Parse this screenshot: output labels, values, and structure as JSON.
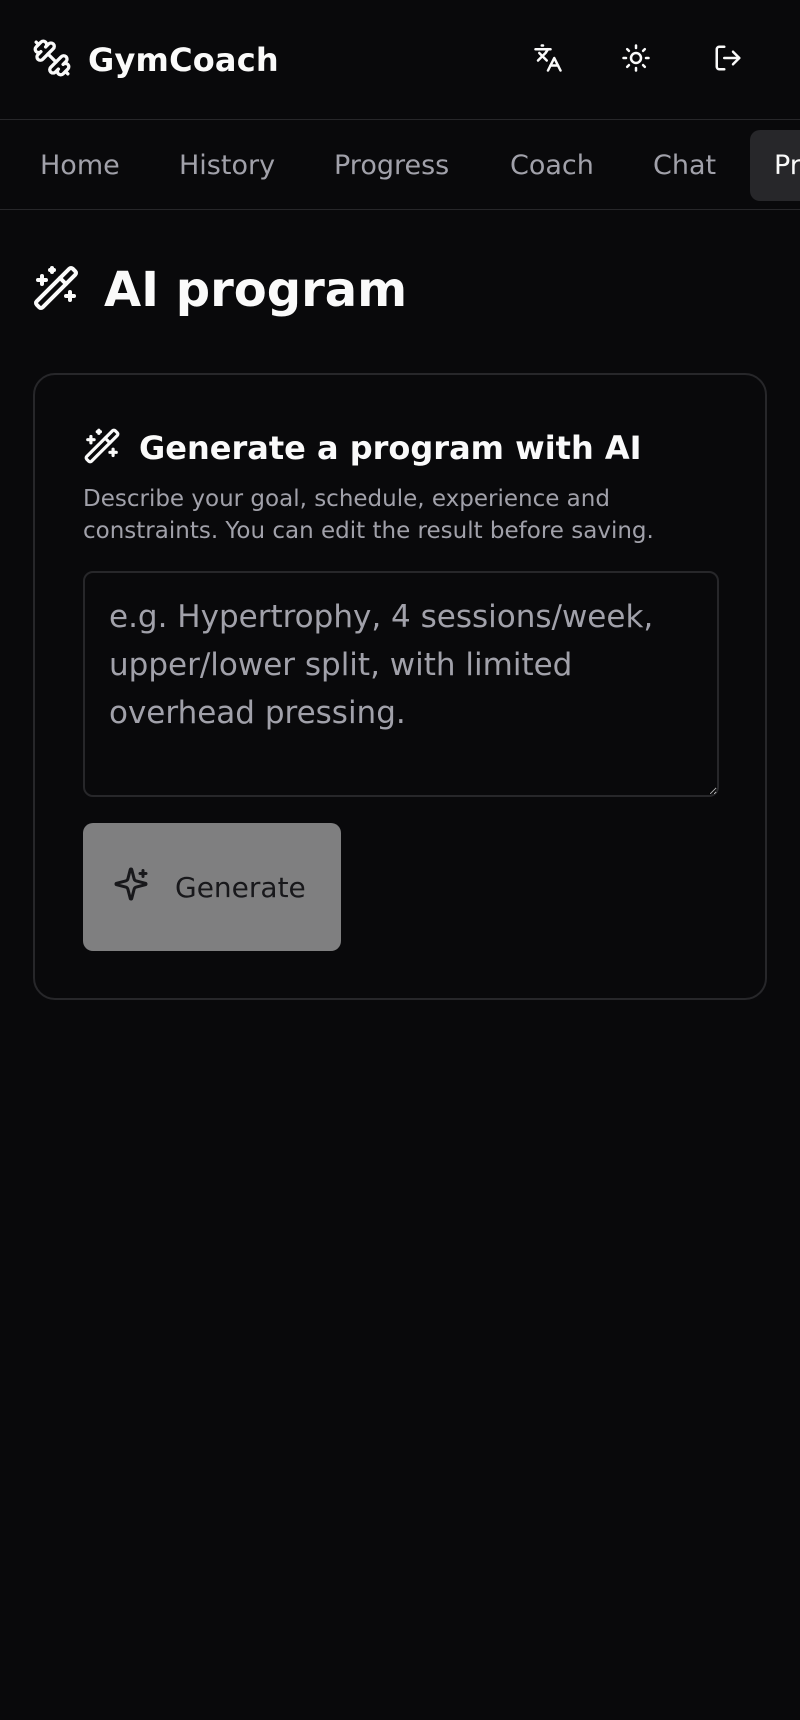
{
  "app": {
    "name": "GymCoach"
  },
  "header": {
    "icons": [
      "dumbbell-icon",
      "translate-icon",
      "sun-icon",
      "log-out-icon"
    ]
  },
  "nav": {
    "tabs": [
      {
        "label": "Home"
      },
      {
        "label": "History"
      },
      {
        "label": "Progress"
      },
      {
        "label": "Coach"
      },
      {
        "label": "Chat"
      },
      {
        "label": "Pr"
      }
    ],
    "active_tab_index": 5
  },
  "page": {
    "title": "AI program",
    "icon": "magic-wand-icon"
  },
  "card": {
    "title": "Generate a program with AI",
    "description": "Describe your goal, schedule, experience and constraints. You can edit the result before saving.",
    "prompt_value": "",
    "prompt_placeholder": "e.g. Hypertrophy, 4 sessions/week, upper/lower split, with limited overhead pressing.",
    "generate_label": "Generate",
    "generate_icon": "sparkles-icon"
  },
  "colors": {
    "background": "#09090b",
    "border": "#27272a",
    "text": "#fafafa",
    "muted_text": "#a1a1aa",
    "active_tab_bg": "#27272a",
    "disabled_button_bg": "#7f7f80"
  }
}
